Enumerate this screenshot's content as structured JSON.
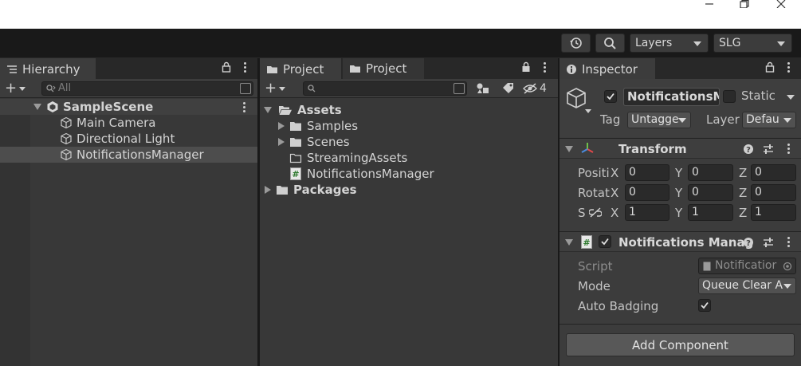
{
  "window": {
    "minimize_icon": "minimize-icon",
    "restore_icon": "restore-icon",
    "close_icon": "close-icon"
  },
  "toolbar": {
    "history_icon": "history-icon",
    "search_icon": "search-icon",
    "layers_label": "Layers",
    "layout_label": "SLG"
  },
  "hierarchy": {
    "tab_label": "Hierarchy",
    "search_placeholder": "All",
    "scene_name": "SampleScene",
    "objects": [
      {
        "label": "Main Camera"
      },
      {
        "label": "Directional Light"
      },
      {
        "label": "NotificationsManager",
        "selected": true
      }
    ]
  },
  "project": {
    "tab1_label": "Project",
    "tab2_label": "Project",
    "hidden_count": "4",
    "root": "Assets",
    "children": [
      {
        "label": "Samples",
        "type": "folder",
        "expandable": true
      },
      {
        "label": "Scenes",
        "type": "folder",
        "expandable": true
      },
      {
        "label": "StreamingAssets",
        "type": "empty-folder",
        "expandable": false
      },
      {
        "label": "NotificationsManager",
        "type": "script",
        "expandable": false
      }
    ],
    "packages": "Packages"
  },
  "inspector": {
    "tab_label": "Inspector",
    "object_name": "NotificationsMa",
    "active": true,
    "static_label": "Static",
    "tag_label": "Tag",
    "tag_value": "Untagge",
    "layer_label": "Layer",
    "layer_value": "Defau",
    "transform": {
      "title": "Transform",
      "position_label": "Positi",
      "rotation_label": "Rotat",
      "scale_label": "S",
      "axis_x": "X",
      "axis_y": "Y",
      "axis_z": "Z",
      "position": [
        "0",
        "0",
        "0"
      ],
      "rotation": [
        "0",
        "0",
        "0"
      ],
      "scale": [
        "1",
        "1",
        "1"
      ]
    },
    "script_component": {
      "title": "Notifications Manag",
      "enabled": true,
      "script_label": "Script",
      "script_value": "Notificatior",
      "mode_label": "Mode",
      "mode_value": "Queue Clear A",
      "auto_badging_label": "Auto Badging",
      "auto_badging": true
    },
    "add_component_label": "Add Component"
  },
  "colors": {
    "panel": "#383838",
    "toolbar": "#191919",
    "selection": "#4d4d4d",
    "accent_green": "#6fbf4a"
  }
}
